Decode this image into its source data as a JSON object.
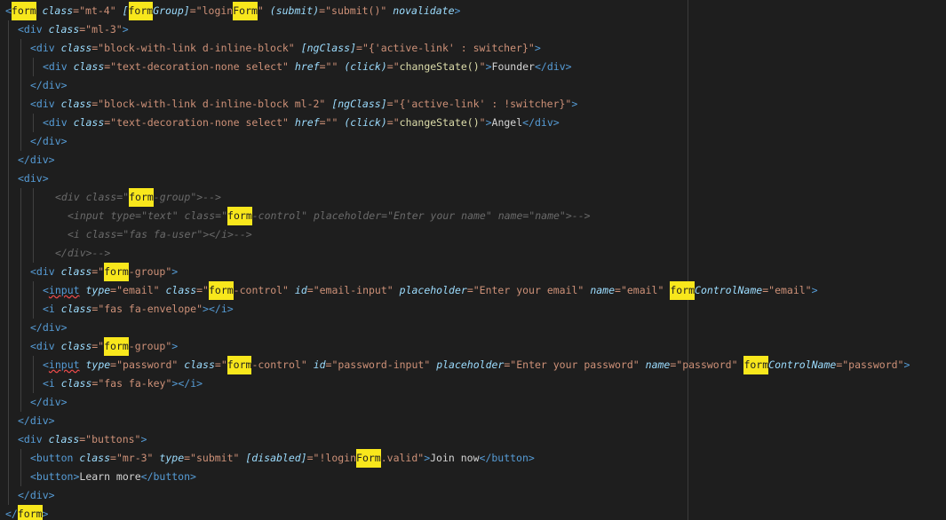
{
  "editor": {
    "colors": {
      "background": "#1e1e1e",
      "tag": "#569cd6",
      "attribute": "#9cdcfe",
      "string": "#ce9178",
      "text": "#d4d4d4",
      "function": "#dcdcaa",
      "comment": "#6a6a6a",
      "search_highlight": "#f8e71c"
    },
    "lines": [
      {
        "indent": 0,
        "tokens": [
          {
            "t": "<",
            "c": "tag"
          },
          {
            "t": "form",
            "c": "tag",
            "hl": true
          },
          {
            "t": " ",
            "c": "text"
          },
          {
            "t": "class",
            "c": "attr"
          },
          {
            "t": "=\"mt-4\" ",
            "c": "str"
          },
          {
            "t": "[",
            "c": "attr"
          },
          {
            "t": "form",
            "c": "attr",
            "hl": true
          },
          {
            "t": "Group]",
            "c": "attr"
          },
          {
            "t": "=\"login",
            "c": "str"
          },
          {
            "t": "Form",
            "c": "str",
            "hl": true
          },
          {
            "t": "\" ",
            "c": "str"
          },
          {
            "t": "(submit)",
            "c": "attr"
          },
          {
            "t": "=\"submit()\" ",
            "c": "str"
          },
          {
            "t": "novalidate",
            "c": "attr"
          },
          {
            "t": ">",
            "c": "tag"
          }
        ]
      },
      {
        "indent": 1,
        "tokens": [
          {
            "t": "<div ",
            "c": "tag"
          },
          {
            "t": "class",
            "c": "attr"
          },
          {
            "t": "=\"ml-3\"",
            "c": "str"
          },
          {
            "t": ">",
            "c": "tag"
          }
        ]
      },
      {
        "indent": 2,
        "tokens": [
          {
            "t": "<div ",
            "c": "tag"
          },
          {
            "t": "class",
            "c": "attr"
          },
          {
            "t": "=\"block-with-link d-inline-block\" ",
            "c": "str"
          },
          {
            "t": "[ngClass]",
            "c": "attr"
          },
          {
            "t": "=\"{'active-link' : switcher}\"",
            "c": "str"
          },
          {
            "t": ">",
            "c": "tag"
          }
        ]
      },
      {
        "indent": 3,
        "tokens": [
          {
            "t": "<div ",
            "c": "tag"
          },
          {
            "t": "class",
            "c": "attr"
          },
          {
            "t": "=\"text-decoration-none select\" ",
            "c": "str"
          },
          {
            "t": "href",
            "c": "attr"
          },
          {
            "t": "=\"\" ",
            "c": "str"
          },
          {
            "t": "(click)",
            "c": "attr"
          },
          {
            "t": "=\"",
            "c": "str"
          },
          {
            "t": "changeState()",
            "c": "fn"
          },
          {
            "t": "\"",
            "c": "str"
          },
          {
            "t": ">",
            "c": "tag"
          },
          {
            "t": "Founder",
            "c": "text"
          },
          {
            "t": "</div>",
            "c": "tag"
          }
        ]
      },
      {
        "indent": 2,
        "tokens": [
          {
            "t": "</div>",
            "c": "tag"
          }
        ]
      },
      {
        "indent": 2,
        "tokens": [
          {
            "t": "<div ",
            "c": "tag"
          },
          {
            "t": "class",
            "c": "attr"
          },
          {
            "t": "=\"block-with-link d-inline-block ml-2\" ",
            "c": "str"
          },
          {
            "t": "[ngClass]",
            "c": "attr"
          },
          {
            "t": "=\"{'active-link' : !switcher}\"",
            "c": "str"
          },
          {
            "t": ">",
            "c": "tag"
          }
        ]
      },
      {
        "indent": 3,
        "tokens": [
          {
            "t": "<div ",
            "c": "tag"
          },
          {
            "t": "class",
            "c": "attr"
          },
          {
            "t": "=\"text-decoration-none select\" ",
            "c": "str"
          },
          {
            "t": "href",
            "c": "attr"
          },
          {
            "t": "=\"\" ",
            "c": "str"
          },
          {
            "t": "(click)",
            "c": "attr"
          },
          {
            "t": "=\"",
            "c": "str"
          },
          {
            "t": "changeState()",
            "c": "fn"
          },
          {
            "t": "\"",
            "c": "str"
          },
          {
            "t": ">",
            "c": "tag"
          },
          {
            "t": "Angel",
            "c": "text"
          },
          {
            "t": "</div>",
            "c": "tag"
          }
        ]
      },
      {
        "indent": 2,
        "tokens": [
          {
            "t": "</div>",
            "c": "tag"
          }
        ]
      },
      {
        "indent": 1,
        "tokens": [
          {
            "t": "</div>",
            "c": "tag"
          }
        ]
      },
      {
        "indent": 1,
        "tokens": [
          {
            "t": "<div>",
            "c": "tag"
          }
        ]
      },
      {
        "indent": 4,
        "tokens": [
          {
            "t": "<div class=\"",
            "c": "cmt"
          },
          {
            "t": "form",
            "c": "cmt",
            "hl": true
          },
          {
            "t": "-group\">-->",
            "c": "cmt"
          }
        ]
      },
      {
        "indent": 5,
        "tokens": [
          {
            "t": "<input type=\"text\" class=\"",
            "c": "cmt"
          },
          {
            "t": "form",
            "c": "cmt",
            "hl": true
          },
          {
            "t": "-control\" placeholder=\"Enter your name\" name=\"name\">-->",
            "c": "cmt"
          }
        ]
      },
      {
        "indent": 5,
        "tokens": [
          {
            "t": "<i class=\"fas fa-user\"></i>-->",
            "c": "cmt"
          }
        ]
      },
      {
        "indent": 4,
        "tokens": [
          {
            "t": "</div>-->",
            "c": "cmt"
          }
        ]
      },
      {
        "indent": 2,
        "tokens": [
          {
            "t": "<div ",
            "c": "tag"
          },
          {
            "t": "class",
            "c": "attr"
          },
          {
            "t": "=\"",
            "c": "str"
          },
          {
            "t": "form",
            "c": "str",
            "hl": true
          },
          {
            "t": "-group\"",
            "c": "str"
          },
          {
            "t": ">",
            "c": "tag"
          }
        ]
      },
      {
        "indent": 3,
        "tokens": [
          {
            "t": "<",
            "c": "tag"
          },
          {
            "t": "input",
            "c": "tag",
            "err": true
          },
          {
            "t": " ",
            "c": "text"
          },
          {
            "t": "type",
            "c": "attr"
          },
          {
            "t": "=\"email\" ",
            "c": "str"
          },
          {
            "t": "class",
            "c": "attr"
          },
          {
            "t": "=\"",
            "c": "str"
          },
          {
            "t": "form",
            "c": "str",
            "hl": true
          },
          {
            "t": "-control\" ",
            "c": "str"
          },
          {
            "t": "id",
            "c": "attr"
          },
          {
            "t": "=\"email-input\" ",
            "c": "str"
          },
          {
            "t": "placeholder",
            "c": "attr"
          },
          {
            "t": "=\"Enter your email\" ",
            "c": "str"
          },
          {
            "t": "name",
            "c": "attr"
          },
          {
            "t": "=\"email\" ",
            "c": "str"
          },
          {
            "t": "form",
            "c": "attr",
            "hl": true
          },
          {
            "t": "ControlName",
            "c": "attr"
          },
          {
            "t": "=\"email\"",
            "c": "str"
          },
          {
            "t": ">",
            "c": "tag"
          }
        ]
      },
      {
        "indent": 3,
        "tokens": [
          {
            "t": "<i ",
            "c": "tag"
          },
          {
            "t": "class",
            "c": "attr"
          },
          {
            "t": "=\"fas fa-envelope\"",
            "c": "str"
          },
          {
            "t": "></i>",
            "c": "tag"
          }
        ]
      },
      {
        "indent": 2,
        "tokens": [
          {
            "t": "</div>",
            "c": "tag"
          }
        ]
      },
      {
        "indent": 2,
        "tokens": [
          {
            "t": "<div ",
            "c": "tag"
          },
          {
            "t": "class",
            "c": "attr"
          },
          {
            "t": "=\"",
            "c": "str"
          },
          {
            "t": "form",
            "c": "str",
            "hl": true
          },
          {
            "t": "-group\"",
            "c": "str"
          },
          {
            "t": ">",
            "c": "tag"
          }
        ]
      },
      {
        "indent": 3,
        "tokens": [
          {
            "t": "<",
            "c": "tag"
          },
          {
            "t": "input",
            "c": "tag",
            "err": true
          },
          {
            "t": " ",
            "c": "text"
          },
          {
            "t": "type",
            "c": "attr"
          },
          {
            "t": "=\"password\" ",
            "c": "str"
          },
          {
            "t": "class",
            "c": "attr"
          },
          {
            "t": "=\"",
            "c": "str"
          },
          {
            "t": "form",
            "c": "str",
            "hl": true
          },
          {
            "t": "-control\" ",
            "c": "str"
          },
          {
            "t": "id",
            "c": "attr"
          },
          {
            "t": "=\"password-input\" ",
            "c": "str"
          },
          {
            "t": "placeholder",
            "c": "attr"
          },
          {
            "t": "=\"Enter your password\" ",
            "c": "str"
          },
          {
            "t": "name",
            "c": "attr"
          },
          {
            "t": "=\"password\" ",
            "c": "str"
          },
          {
            "t": "form",
            "c": "attr",
            "hl": true
          },
          {
            "t": "ControlName",
            "c": "attr"
          },
          {
            "t": "=\"password\"",
            "c": "str"
          },
          {
            "t": ">",
            "c": "tag"
          }
        ]
      },
      {
        "indent": 3,
        "tokens": [
          {
            "t": "<i ",
            "c": "tag"
          },
          {
            "t": "class",
            "c": "attr"
          },
          {
            "t": "=\"fas fa-key\"",
            "c": "str"
          },
          {
            "t": "></i>",
            "c": "tag"
          }
        ]
      },
      {
        "indent": 2,
        "tokens": [
          {
            "t": "</div>",
            "c": "tag"
          }
        ]
      },
      {
        "indent": 1,
        "tokens": [
          {
            "t": "</div>",
            "c": "tag"
          }
        ]
      },
      {
        "indent": 1,
        "tokens": [
          {
            "t": "<div ",
            "c": "tag"
          },
          {
            "t": "class",
            "c": "attr"
          },
          {
            "t": "=\"buttons\"",
            "c": "str"
          },
          {
            "t": ">",
            "c": "tag"
          }
        ]
      },
      {
        "indent": 2,
        "tokens": [
          {
            "t": "<button ",
            "c": "tag"
          },
          {
            "t": "class",
            "c": "attr"
          },
          {
            "t": "=\"mr-3\" ",
            "c": "str"
          },
          {
            "t": "type",
            "c": "attr"
          },
          {
            "t": "=\"submit\" ",
            "c": "str"
          },
          {
            "t": "[disabled]",
            "c": "attr"
          },
          {
            "t": "=\"!login",
            "c": "str"
          },
          {
            "t": "Form",
            "c": "str",
            "hl": true
          },
          {
            "t": ".valid\"",
            "c": "str"
          },
          {
            "t": ">",
            "c": "tag"
          },
          {
            "t": "Join now",
            "c": "text"
          },
          {
            "t": "</button>",
            "c": "tag"
          }
        ]
      },
      {
        "indent": 2,
        "tokens": [
          {
            "t": "<button>",
            "c": "tag"
          },
          {
            "t": "Learn more",
            "c": "text"
          },
          {
            "t": "</button>",
            "c": "tag"
          }
        ]
      },
      {
        "indent": 1,
        "tokens": [
          {
            "t": "</div>",
            "c": "tag"
          }
        ]
      },
      {
        "indent": 0,
        "tokens": [
          {
            "t": "</",
            "c": "tag"
          },
          {
            "t": "form",
            "c": "tag",
            "hl": true
          },
          {
            "t": ">",
            "c": "tag"
          }
        ]
      }
    ]
  }
}
